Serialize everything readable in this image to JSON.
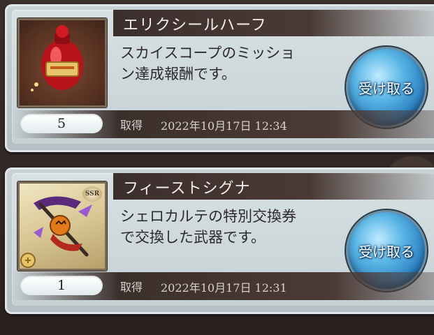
{
  "colors": {
    "title_bar": "#3b2f2d",
    "button_blue": "#2c7fc0",
    "card_bg": "#c9d2d6"
  },
  "items": [
    {
      "name": "エリクシールハーフ",
      "description_line1": "スカイスコープのミッショ",
      "description_line2": "ン達成報酬です。",
      "quantity": "5",
      "acquired_label": "取得",
      "acquired_datetime": "2022年10月17日 12:34",
      "claim_label": "受け取る",
      "thumb_icon": "red-potion-icon"
    },
    {
      "name": "フィーストシグナ",
      "description_line1": "シェロカルテの特別交換券",
      "description_line2": "で交換した武器です。",
      "quantity": "1",
      "acquired_label": "取得",
      "acquired_datetime": "2022年10月17日 12:31",
      "claim_label": "受け取る",
      "thumb_icon": "ssr-weapon-icon",
      "rarity": "SSR"
    }
  ]
}
